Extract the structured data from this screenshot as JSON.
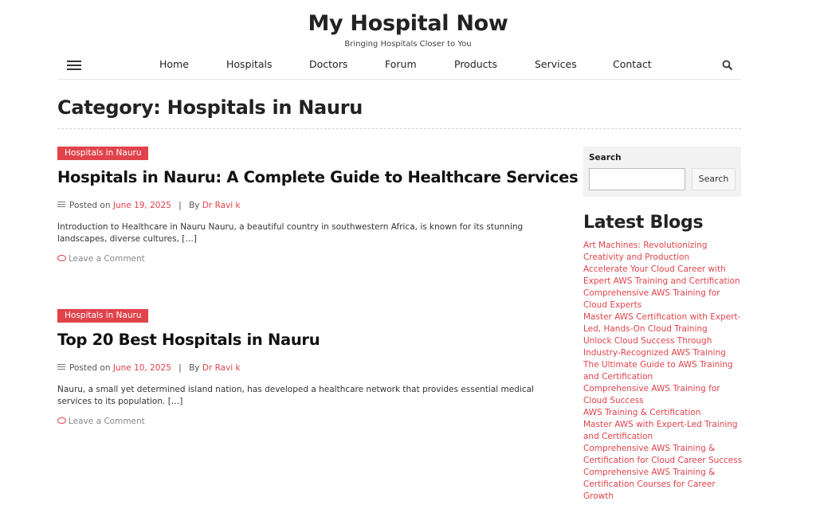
{
  "site": {
    "title": "My Hospital Now",
    "tagline": "Bringing Hospitals Closer to You"
  },
  "nav": {
    "items": [
      "Home",
      "Hospitals",
      "Doctors",
      "Forum",
      "Products",
      "Services",
      "Contact"
    ],
    "menu_icon": "hamburger-menu-icon",
    "search_icon": "search-icon"
  },
  "category": {
    "title": "Category: Hospitals in Nauru"
  },
  "posts": [
    {
      "category": "Hospitals in Nauru",
      "title": "Hospitals in Nauru: A Complete Guide to Healthcare Services",
      "posted_on_label": "Posted on",
      "date": "June 19, 2025",
      "by_label": "By",
      "author": "Dr Ravi k",
      "excerpt": "Introduction to Healthcare in Nauru Nauru, a beautiful country in southwestern Africa, is known for its stunning landscapes, diverse cultures, […]",
      "comment_label": "Leave a Comment"
    },
    {
      "category": "Hospitals in Nauru",
      "title": "Top 20 Best Hospitals in Nauru",
      "posted_on_label": "Posted on",
      "date": "June 10, 2025",
      "by_label": "By",
      "author": "Dr Ravi k",
      "excerpt": "Nauru, a small yet determined island nation, has developed a healthcare network that provides essential medical services to its population. […]",
      "comment_label": "Leave a Comment"
    }
  ],
  "sidebar": {
    "search": {
      "label": "Search",
      "value": "",
      "placeholder": "",
      "button_label": "Search"
    },
    "latest_blogs": {
      "heading": "Latest Blogs",
      "items": [
        "Art Machines: Revolutionizing Creativity and Production",
        "Accelerate Your Cloud Career with Expert AWS Training and Certification",
        "Comprehensive AWS Training for Cloud Experts",
        "Master AWS Certification with Expert-Led, Hands-On Cloud Training",
        "Unlock Cloud Success Through Industry-Recognized AWS Training",
        "The Ultimate Guide to AWS Training and Certification",
        "Comprehensive AWS Training for Cloud Success",
        "AWS Training & Certification",
        "Master AWS with Expert-Led Training and Certification",
        "Comprehensive AWS Training & Certification for Cloud Career Success",
        "Comprehensive AWS Training & Certification Courses for Career Growth"
      ]
    }
  },
  "colors": {
    "accent": "#e0434b",
    "text": "#222222",
    "muted": "#888888"
  }
}
